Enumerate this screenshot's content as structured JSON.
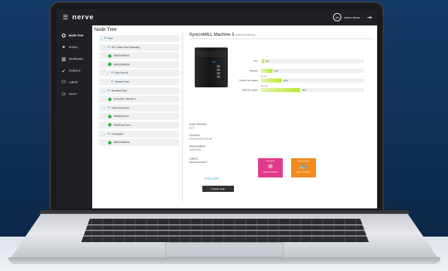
{
  "app": {
    "brand": "nerve",
    "user_initials": "AN",
    "user_name": "Admin Nerve"
  },
  "sidebar": {
    "items": [
      {
        "label": "Node Tree",
        "icon": "node-tree-icon",
        "glyph": "⌬"
      },
      {
        "label": "Nodes",
        "icon": "nodes-icon",
        "glyph": "⚭"
      },
      {
        "label": "Workloads",
        "icon": "workloads-icon",
        "glyph": "▥"
      },
      {
        "label": "Deploy ▸",
        "icon": "deploy-icon",
        "glyph": "➶"
      },
      {
        "label": "Labels",
        "icon": "labels-icon",
        "glyph": "⬭"
      },
      {
        "label": "Users",
        "icon": "users-icon",
        "glyph": "⚇"
      }
    ]
  },
  "tree": {
    "title": "Node Tree",
    "nodes": [
      {
        "label": "Root",
        "kind": "group",
        "indent": 0,
        "expanded": true
      },
      {
        "label": "SPC Trade Show Rosenberg",
        "kind": "group",
        "indent": 1,
        "expanded": true
      },
      {
        "label": "0083CD9D8D02",
        "kind": "node",
        "indent": 2
      },
      {
        "label": "0083CD9D8D05",
        "kind": "node",
        "indent": 2
      },
      {
        "label": "Real Time Kit",
        "kind": "group",
        "indent": 2,
        "expanded": false
      },
      {
        "label": "Siemens Plant",
        "kind": "group",
        "indent": 2,
        "expanded": false
      },
      {
        "label": "Bremtena Plant",
        "kind": "group",
        "indent": 1,
        "expanded": true
      },
      {
        "label": "SyncroMILL Machine 3",
        "kind": "node",
        "indent": 2
      },
      {
        "label": "Hanna Showroom",
        "kind": "group",
        "indent": 1,
        "expanded": true
      },
      {
        "label": "Palletting Demo",
        "kind": "node",
        "indent": 2
      },
      {
        "label": "PickAPlace Demo",
        "kind": "node",
        "indent": 2
      },
      {
        "label": "Unassigned",
        "kind": "group",
        "indent": 1,
        "expanded": true
      },
      {
        "label": "0083CD9D8D04",
        "kind": "node",
        "indent": 2
      }
    ]
  },
  "detail": {
    "name": "SyncroMILL Machine 3",
    "serial": "(0083CD9D8D03)",
    "metrics": [
      {
        "label": "CPU",
        "percent": 3,
        "pct_text": "3%",
        "cap": ""
      },
      {
        "label": "Memory",
        "percent": 11,
        "pct_text": "11%",
        "cap": ""
      },
      {
        "label": "Docker free space",
        "percent": 20,
        "pct_text": "20%",
        "cap": "5.6 GB"
      },
      {
        "label": "USB free space",
        "percent": 38,
        "pct_text": "38%",
        "cap": "51.1 GB"
      }
    ],
    "info": [
      {
        "key": "NODE VERSION:",
        "value": "1.2.3"
      },
      {
        "key": "CREATED:",
        "value": "ILO-09-19 09:21:16 AM"
      },
      {
        "key": "WAN ADDRESS:",
        "value": "10.93.13.81"
      },
      {
        "key": "LABELS:",
        "value": "MachineNumber:3"
      }
    ],
    "show_used": "SHOW USED",
    "delete_label": "Delete node",
    "workloads": [
      {
        "title": "PLC DNA",
        "status": "Status: STARTED",
        "color": "#e23a8a",
        "icon": "plc-workload-icon",
        "glyph": "✲"
      },
      {
        "title": "Nerve Docker",
        "status": "Status: STARTED",
        "color": "#f38a1c",
        "icon": "docker-workload-icon",
        "glyph": "🐳"
      }
    ]
  }
}
